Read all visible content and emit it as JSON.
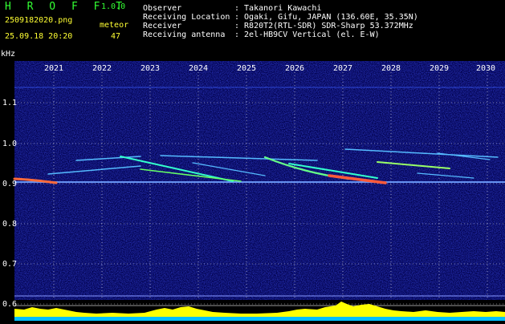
{
  "app": {
    "name": "H R O F F T",
    "version": "1.0.0"
  },
  "file": {
    "name": "2509182020.png",
    "datetime": "25.09.18 20:20"
  },
  "detect": {
    "label": "meteor",
    "count": "47"
  },
  "info": [
    {
      "key": "Observer",
      "value": ": Takanori Kawachi"
    },
    {
      "key": "Receiving Location",
      "value": ": Ogaki, Gifu, JAPAN (136.60E, 35.35N)"
    },
    {
      "key": "Receiver",
      "value": ": R820T2(RTL-SDR) SDR-Sharp 53.372MHz"
    },
    {
      "key": "Receiving antenna",
      "value": ": 2el-HB9CV Vertical (el. E-W)"
    }
  ],
  "axes": {
    "y_unit": "kHz",
    "x_ticks": [
      "2021",
      "2022",
      "2023",
      "2024",
      "2025",
      "2026",
      "2027",
      "2028",
      "2029",
      "2030"
    ],
    "y_ticks": [
      "1.1",
      "1.0",
      "0.9",
      "0.8",
      "0.7",
      "0.6"
    ]
  },
  "colors": {
    "background": "#00004a",
    "accent_green": "#33ff33",
    "accent_yellow": "#ffff33",
    "level_fill": "#ffff00",
    "level_base": "#00bfff"
  }
}
